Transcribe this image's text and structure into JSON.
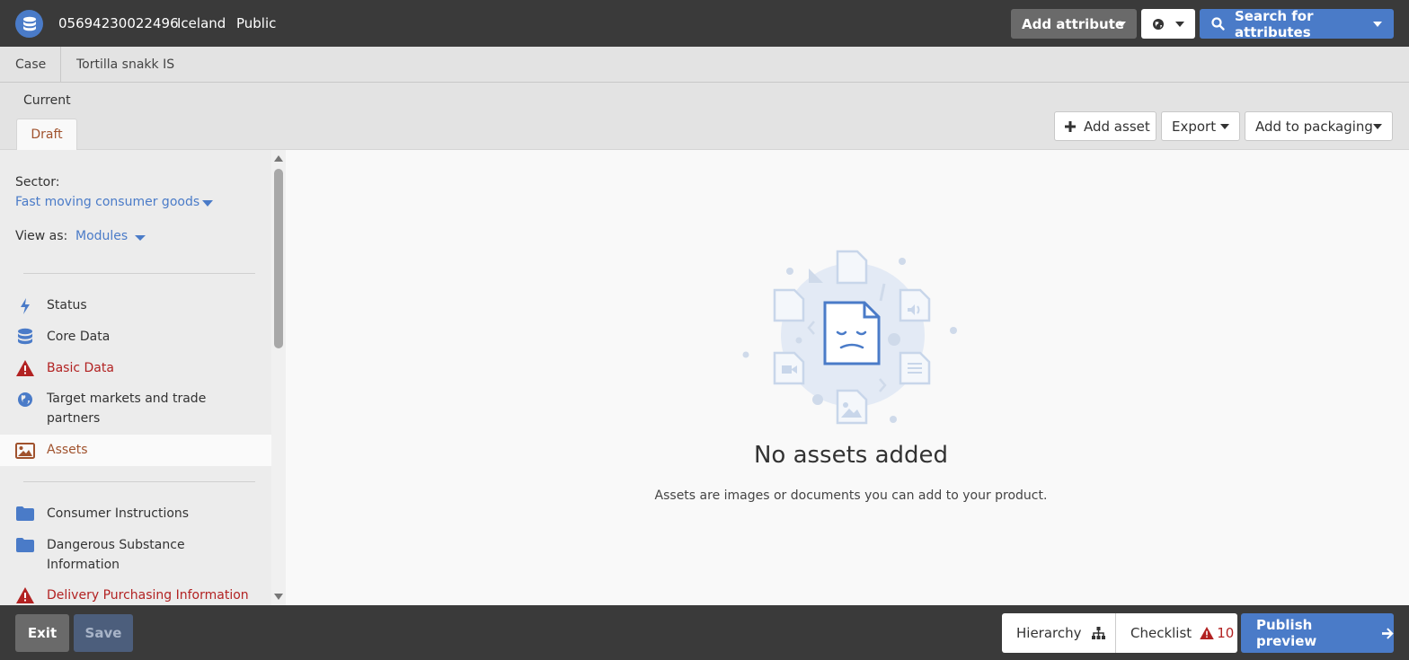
{
  "header": {
    "gtin": "05694230022496",
    "market": "Iceland",
    "visibility": "Public",
    "add_attribute_label": "Add attribute",
    "search_attributes_label": "Search for attributes",
    "logo_icon": "database-icon",
    "globe_icon": "globe-icon"
  },
  "breadcrumb": {
    "type": "Case",
    "name": "Tortilla snakk IS"
  },
  "version": {
    "current_label": "Current",
    "tab_draft": "Draft",
    "add_asset_label": "Add asset",
    "export_label": "Export",
    "add_to_packaging_label": "Add to packaging"
  },
  "sidebar": {
    "sector_label": "Sector:",
    "sector_value": "Fast moving consumer goods",
    "view_as_label": "View as:",
    "view_as_value": "Modules",
    "items": [
      {
        "label": "Status",
        "icon": "bolt-icon",
        "state": "normal"
      },
      {
        "label": "Core Data",
        "icon": "database-icon",
        "state": "normal"
      },
      {
        "label": "Basic Data",
        "icon": "warning-icon",
        "state": "error"
      },
      {
        "label": "Target markets and trade partners",
        "icon": "globe-icon",
        "state": "normal"
      },
      {
        "label": "Assets",
        "icon": "image-icon",
        "state": "active"
      },
      {
        "label": "Consumer Instructions",
        "icon": "folder-icon",
        "state": "normal"
      },
      {
        "label": "Dangerous Substance Information",
        "icon": "folder-icon",
        "state": "normal"
      },
      {
        "label": "Delivery Purchasing Information",
        "icon": "warning-icon",
        "state": "error"
      }
    ]
  },
  "main": {
    "empty_title": "No assets added",
    "empty_description": "Assets are images or documents you can add to your product."
  },
  "footer": {
    "exit_label": "Exit",
    "save_label": "Save",
    "hierarchy_label": "Hierarchy",
    "checklist_label": "Checklist",
    "checklist_count": "10",
    "publish_label": "Publish preview"
  },
  "colors": {
    "accent_blue": "#4a7bc8",
    "error_red": "#b22222",
    "active_brown": "#a0522d",
    "dark_bar": "#3a3a3a"
  }
}
